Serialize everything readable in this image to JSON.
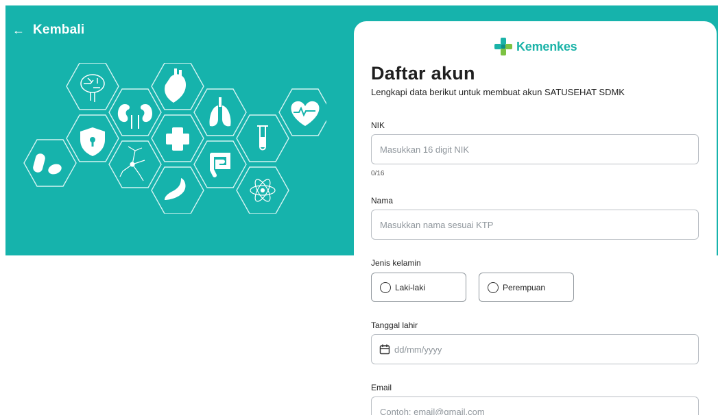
{
  "header": {
    "back_icon": "arrow-left-icon",
    "back_label": "Kembali"
  },
  "illustration": {
    "icons": [
      "brain-icon",
      "heart-organ-icon",
      "kidney-icon",
      "lungs-icon",
      "heartbeat-icon",
      "shield-lock-icon",
      "medical-cross-icon",
      "test-tube-icon",
      "pills-icon",
      "neuron-icon",
      "intestine-icon",
      "stomach-icon",
      "atom-icon"
    ]
  },
  "brand": {
    "logo_text": "Kemenkes",
    "colors": {
      "primary": "#16b3ac",
      "logo_green": "#7cc242",
      "logo_teal": "#1bb3a8"
    }
  },
  "form": {
    "title": "Daftar akun",
    "subtitle": "Lengkapi data berikut untuk membuat akun SATUSEHAT SDMK",
    "nik": {
      "label": "NIK",
      "placeholder": "Masukkan 16 digit NIK",
      "counter": "0/16"
    },
    "nama": {
      "label": "Nama",
      "placeholder": "Masukkan nama sesuai KTP"
    },
    "gender": {
      "label": "Jenis kelamin",
      "options": [
        "Laki-laki",
        "Perempuan"
      ]
    },
    "dob": {
      "label": "Tanggal lahir",
      "placeholder": "dd/mm/yyyy",
      "icon": "calendar-icon"
    },
    "email": {
      "label": "Email",
      "placeholder": "Contoh: email@gmail.com"
    }
  }
}
